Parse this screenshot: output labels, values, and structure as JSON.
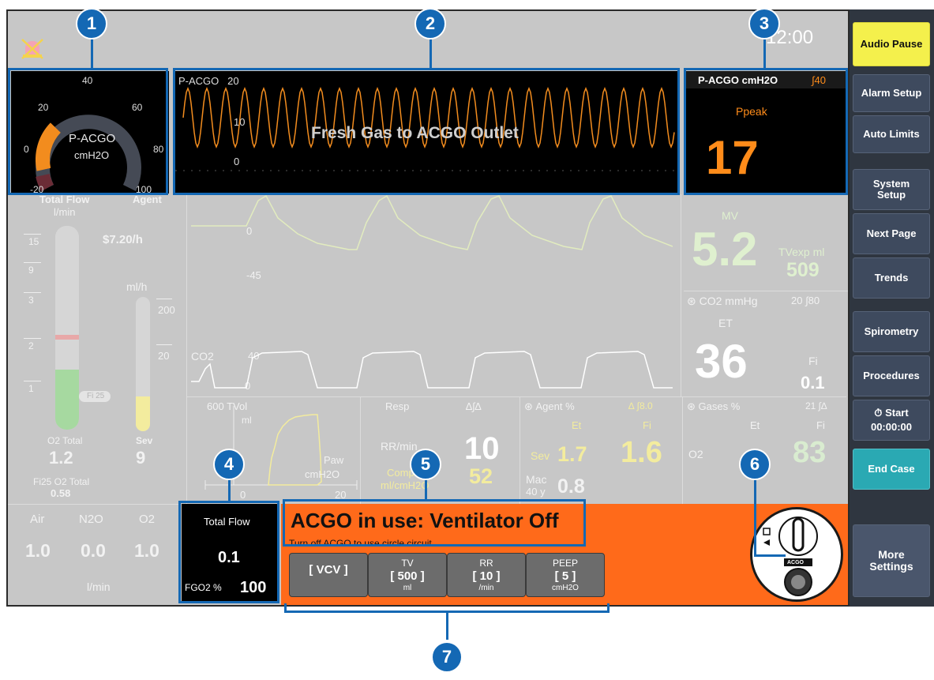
{
  "header": {
    "time": "12:00"
  },
  "gauge": {
    "label": "P-ACGO",
    "unit": "cmH2O",
    "ticks": {
      "t40": "40",
      "t20": "20",
      "t60": "60",
      "t0": "0",
      "t80": "80",
      "tm20": "-20",
      "t100": "100"
    },
    "value_fraction": 0.33,
    "arc_color": "#f28c1e"
  },
  "waveform": {
    "label": "P-ACGO",
    "top_value": "20",
    "mid_value": "10",
    "zero_value": "0",
    "banner": "Fresh Gas to ACGO Outlet",
    "color": "#f28c1e"
  },
  "peak": {
    "title": "P-ACGO cmH2O",
    "limit": "∫40",
    "label": "Ppeak",
    "value": "17",
    "color": "#ff8c1a"
  },
  "flow_panel": {
    "total_flow_label": "Total Flow",
    "total_flow_unit": "l/min",
    "agent_label": "Agent",
    "cost": "$7.20/h",
    "mlh_unit": "ml/h",
    "ticks": {
      "t15": "15",
      "t9": "9",
      "t3": "3",
      "t2": "2",
      "t1": "1"
    },
    "agent_ticks": {
      "t200": "200",
      "t20": "20"
    },
    "fi25_tag": "Fi 25",
    "o2_total_label": "O2 Total",
    "o2_total_value": "1.2",
    "sev_label": "Sev",
    "sev_value": "9",
    "fi25_label": "Fi25 O2 Total",
    "fi25_value": "0.58"
  },
  "gas_flows": {
    "air_label": "Air",
    "n2o_label": "N2O",
    "o2_label": "O2",
    "air_value": "1.0",
    "n2o_value": "0.0",
    "o2_value": "1.0",
    "unit": "l/min"
  },
  "center_waves": {
    "paw_zero": "0",
    "paw_neg": "-45",
    "co2_label": "CO2",
    "co2_40": "40",
    "co2_zero": "0"
  },
  "loop": {
    "vol_label": "600 TVol",
    "vol_unit": "ml",
    "paw_label": "Paw",
    "paw_unit": "cmH2O",
    "x0": "0",
    "x20": "20"
  },
  "resp": {
    "title": "Resp",
    "icons": "∆∫∆",
    "rr_label": "RR/min",
    "rr_value": "10",
    "comp_label": "Comp",
    "comp_unit": "ml/cmH2O",
    "comp_value": "52"
  },
  "agent": {
    "title": "Agent %",
    "limit": "∆ ∫8.0",
    "et": "Et",
    "fi": "Fi",
    "sev": "Sev",
    "sev_et": "1.7",
    "sev_fi": "1.6",
    "mac_label": "Mac",
    "mac_age": "40 y",
    "mac_value": "0.8"
  },
  "gases": {
    "title": "Gases %",
    "limit": "21 ∫∆",
    "et": "Et",
    "fi": "Fi",
    "o2": "O2",
    "o2_fi": "83"
  },
  "mv": {
    "label": "MV",
    "value": "5.2",
    "tv_label": "TVexp ml",
    "tv_value": "509"
  },
  "co2": {
    "label": "CO2 mmHg",
    "limits": "20 ∫80",
    "et_label": "ET",
    "et_value": "36",
    "fi_label": "Fi",
    "fi_value": "0.1"
  },
  "total_flow_box": {
    "label": "Total Flow",
    "value": "0.1",
    "fgo2_label": "FGO2 %",
    "fgo2_value": "100"
  },
  "alarm": {
    "title": "ACGO in use: Ventilator Off",
    "subtitle": "Turn off ACGO to use circle circuit.",
    "bg": "#ff6a1a",
    "buttons": [
      {
        "top": "",
        "mid": "[ VCV ]",
        "bottom": ""
      },
      {
        "top": "TV",
        "mid": "[ 500 ]",
        "bottom": "ml"
      },
      {
        "top": "RR",
        "mid": "[ 10 ]",
        "bottom": "/min"
      },
      {
        "top": "PEEP",
        "mid": "[ 5 ]",
        "bottom": "cmH2O"
      }
    ],
    "acgo_label": "ACGO"
  },
  "sidebar": {
    "audio_pause": "Audio Pause",
    "alarm_setup": "Alarm Setup",
    "auto_limits": "Auto Limits",
    "system_setup": "System Setup",
    "next_page": "Next Page",
    "trends": "Trends",
    "spirometry": "Spirometry",
    "procedures": "Procedures",
    "start_label": "Start",
    "start_time": "00:00:00",
    "end_case": "End Case",
    "more_settings": "More Settings"
  },
  "callouts": [
    "1",
    "2",
    "3",
    "4",
    "5",
    "6",
    "7"
  ],
  "colors": {
    "callout_blue": "#1468b4",
    "screen_bg": "#c7c7c7",
    "sidebar_bg": "#2f3640",
    "yellow_btn": "#f4f04c",
    "teal_btn": "#2aa9b3"
  }
}
